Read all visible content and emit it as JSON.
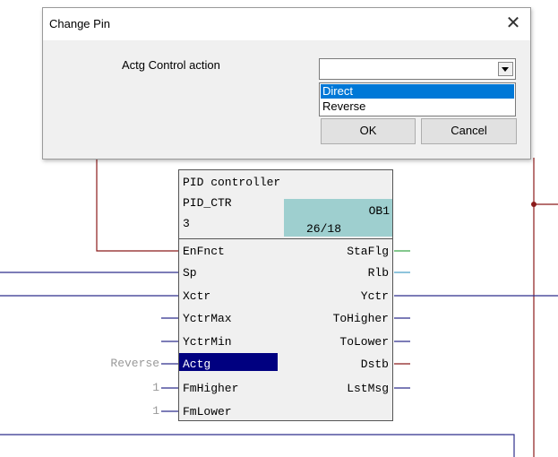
{
  "dialog": {
    "title": "Change Pin",
    "close_glyph": "✕",
    "pin_label": "Actg  Control action",
    "combo_value": "",
    "options": [
      "Direct",
      "Reverse"
    ],
    "selected_option": "Direct",
    "ok_label": "OK",
    "cancel_label": "Cancel"
  },
  "block": {
    "title": "PID controller",
    "type_name": "PID_CTR",
    "number": "3",
    "ob_label": "OB1",
    "position": "26/18",
    "inputs": [
      {
        "name": "EnFnct",
        "value": ""
      },
      {
        "name": "Sp",
        "value": ""
      },
      {
        "name": "Xctr",
        "value": ""
      },
      {
        "name": "YctrMax",
        "value": ""
      },
      {
        "name": "YctrMin",
        "value": ""
      },
      {
        "name": "Actg",
        "value": "Reverse"
      },
      {
        "name": "FmHigher",
        "value": "1"
      },
      {
        "name": "FmLower",
        "value": "1"
      }
    ],
    "outputs": [
      "StaFlg",
      "Rlb",
      "Yctr",
      "ToHigher",
      "ToLower",
      "Dstb",
      "LstMsg"
    ]
  },
  "colors": {
    "wire_blue": "#2e2e8c",
    "wire_red": "#8b1a1a",
    "wire_green": "#3aa64a",
    "wire_cyan": "#4aa0c8",
    "highlight": "#000080",
    "ob_fill": "#9ecfcf"
  }
}
